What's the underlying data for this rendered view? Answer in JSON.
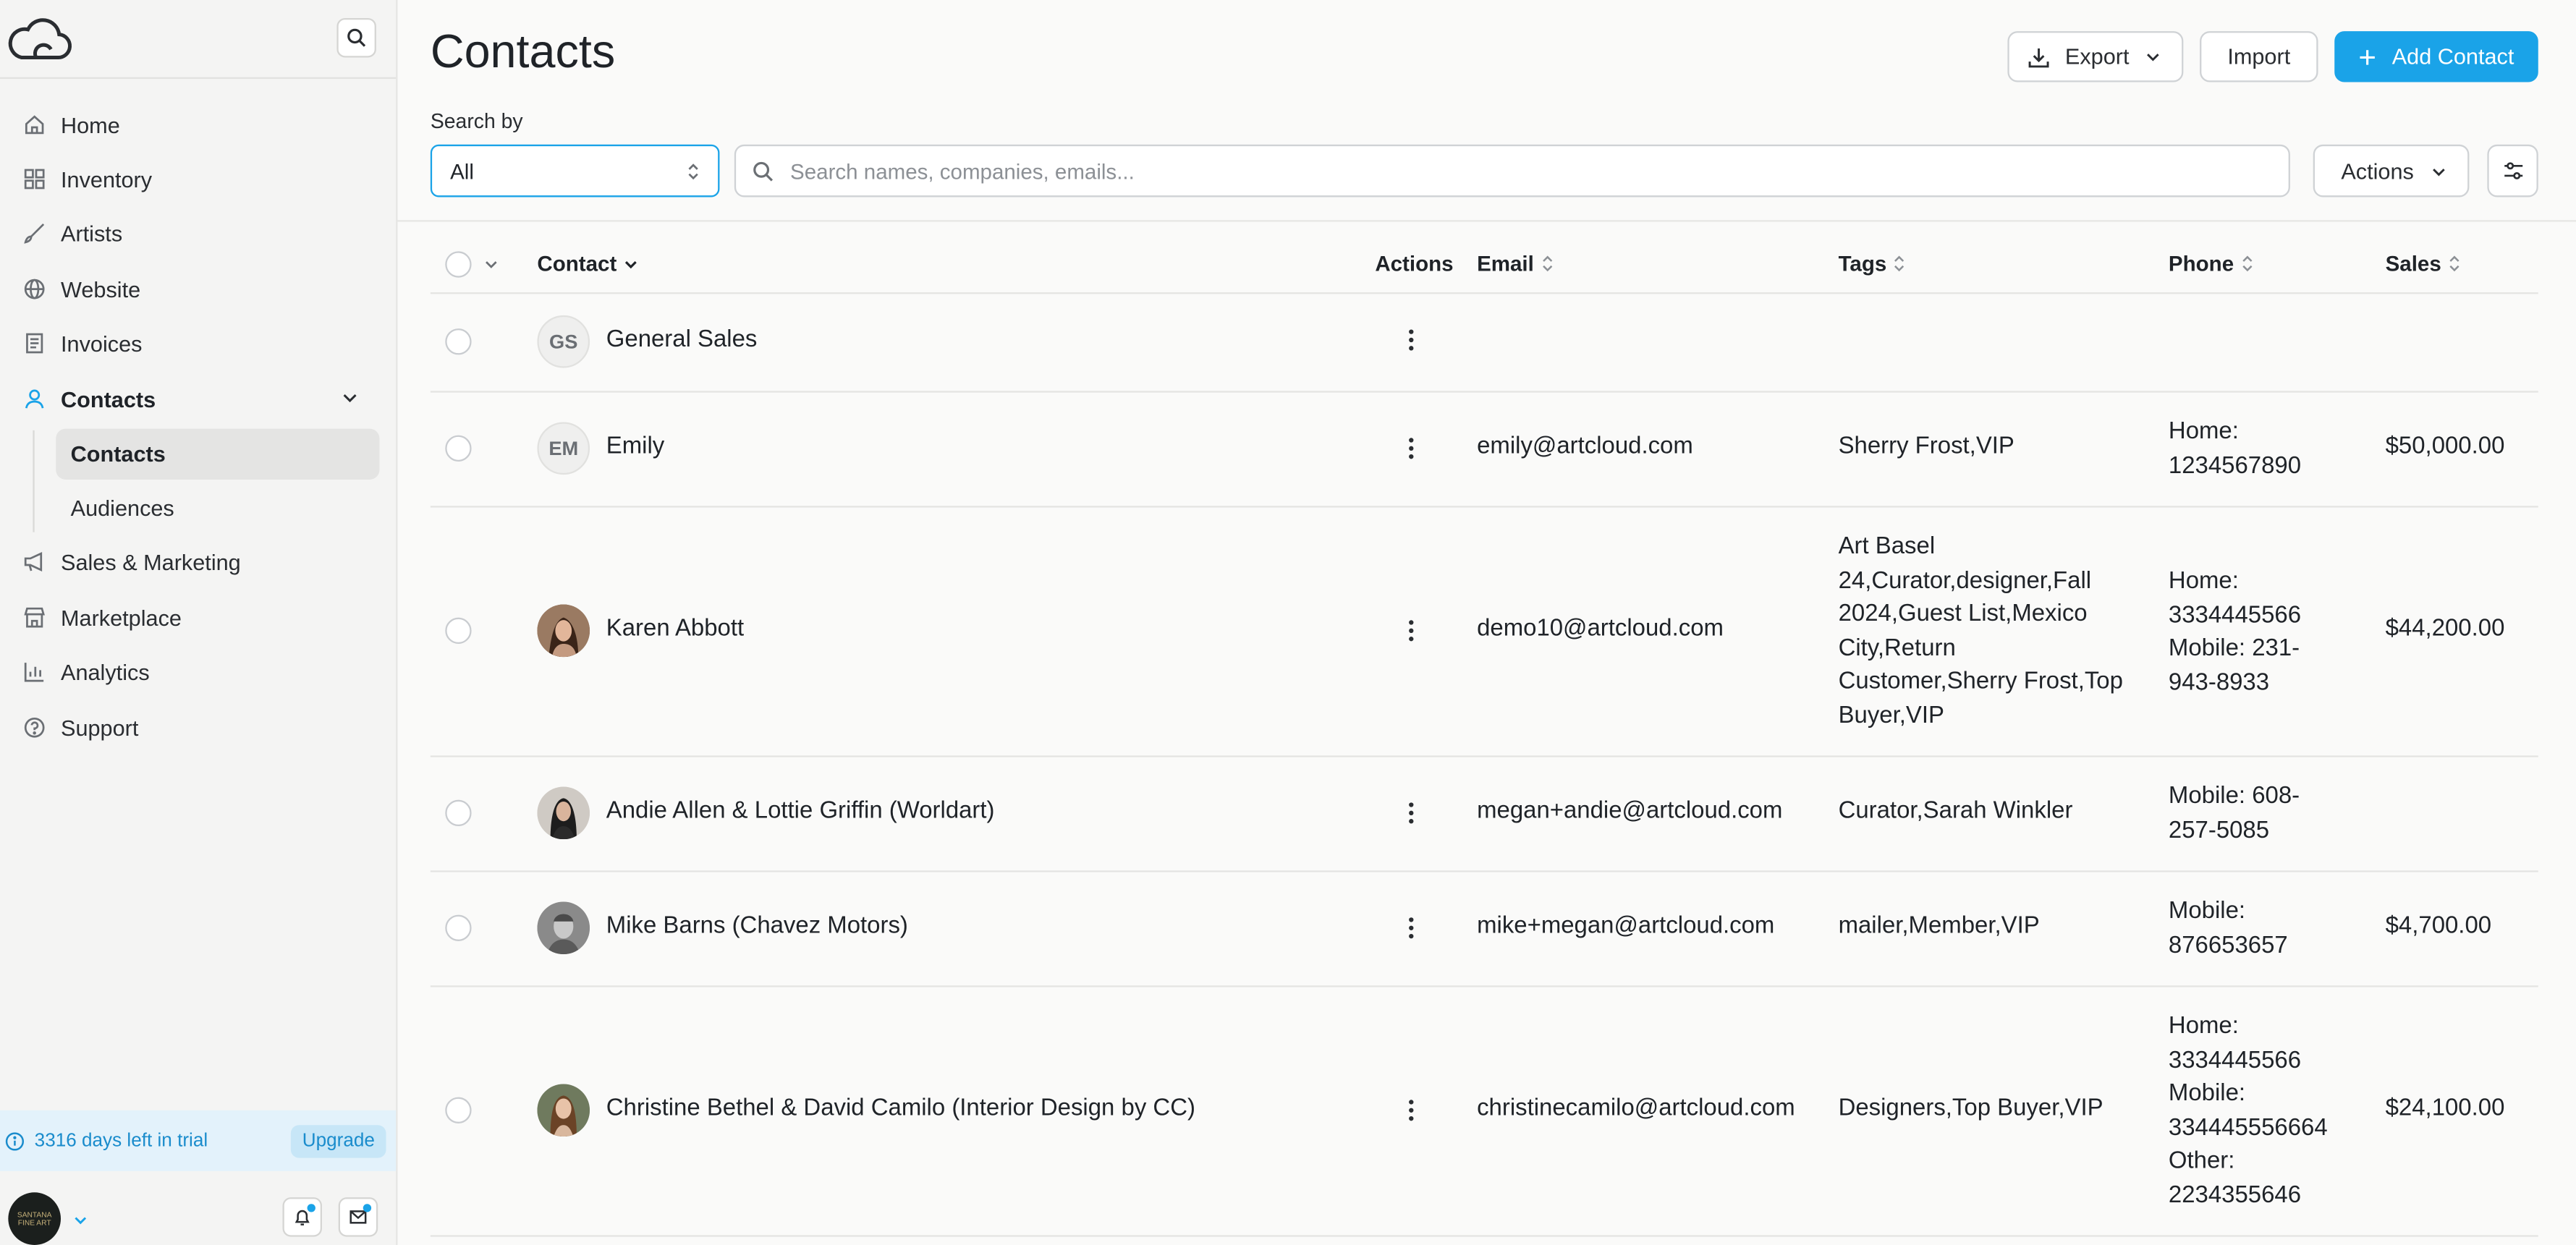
{
  "sidebar": {
    "items": [
      {
        "label": "Home",
        "icon": "home-icon"
      },
      {
        "label": "Inventory",
        "icon": "grid-icon"
      },
      {
        "label": "Artists",
        "icon": "brush-icon"
      },
      {
        "label": "Website",
        "icon": "globe-icon"
      },
      {
        "label": "Invoices",
        "icon": "document-icon"
      },
      {
        "label": "Contacts",
        "icon": "user-icon"
      },
      {
        "label": "Sales & Marketing",
        "icon": "megaphone-icon"
      },
      {
        "label": "Marketplace",
        "icon": "store-icon"
      },
      {
        "label": "Analytics",
        "icon": "bar-chart-icon"
      },
      {
        "label": "Support",
        "icon": "help-circle-icon"
      }
    ],
    "sub_items": [
      {
        "label": "Contacts",
        "selected": true
      },
      {
        "label": "Audiences",
        "selected": false
      }
    ],
    "trial_text": "3316 days left in trial",
    "upgrade_label": "Upgrade",
    "org_logo_text": "SANTANA FINE ART"
  },
  "header": {
    "title": "Contacts",
    "export_label": "Export",
    "import_label": "Import",
    "add_label": "Add Contact"
  },
  "search": {
    "label": "Search by",
    "select_value": "All",
    "placeholder": "Search names, companies, emails...",
    "actions_label": "Actions"
  },
  "table": {
    "columns": {
      "contact": "Contact",
      "actions": "Actions",
      "email": "Email",
      "tags": "Tags",
      "phone": "Phone",
      "sales": "Sales"
    },
    "rows": [
      {
        "initials": "GS",
        "name": "General Sales",
        "email": "",
        "tags": [],
        "phone": [],
        "sales": ""
      },
      {
        "initials": "EM",
        "name": "Emily",
        "email": "emily@artcloud.com",
        "tags": [
          "Sherry Frost,VIP"
        ],
        "phone": [
          "Home:",
          "1234567890"
        ],
        "sales": "$50,000.00"
      },
      {
        "initials": "",
        "name": "Karen Abbott",
        "email": "demo10@artcloud.com",
        "tags": [
          "Art Basel",
          "24,Curator,designer,Fall",
          "2024,Guest List,Mexico",
          "City,Return",
          "Customer,Sherry Frost,Top",
          "Buyer,VIP"
        ],
        "phone": [
          "Home:",
          "3334445566",
          "Mobile: 231-",
          "943-8933"
        ],
        "sales": "$44,200.00"
      },
      {
        "initials": "",
        "name": "Andie Allen & Lottie Griffin (Worldart)",
        "email": "megan+andie@artcloud.com",
        "tags": [
          "Curator,Sarah Winkler"
        ],
        "phone": [
          "Mobile: 608-",
          "257-5085"
        ],
        "sales": ""
      },
      {
        "initials": "",
        "name": "Mike Barns (Chavez Motors)",
        "email": "mike+megan@artcloud.com",
        "tags": [
          "mailer,Member,VIP"
        ],
        "phone": [
          "Mobile:",
          "876653657"
        ],
        "sales": "$4,700.00"
      },
      {
        "initials": "",
        "name": "Christine Bethel & David Camilo (Interior Design by CC)",
        "email": "christinecamilo@artcloud.com",
        "tags": [
          "Designers,Top Buyer,VIP"
        ],
        "phone": [
          "Home:",
          "3334445566",
          "Mobile:",
          "334445556664",
          "Other:",
          "2234355646"
        ],
        "sales": "$24,100.00"
      }
    ]
  },
  "colors": {
    "accent": "#1aa3e8",
    "sidebar_bg": "#f4f4f3",
    "trial_bg": "#e3f2fb"
  }
}
